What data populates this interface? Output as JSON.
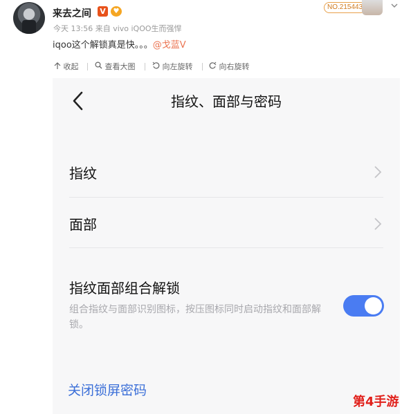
{
  "post": {
    "username": "来去之间",
    "verified_badge": "V",
    "vip_badge": "♥",
    "meta": "今天 13:56 来自 vivo iQOO生而强悍",
    "text": "iqoo这个解锁真是快。。。",
    "mention": "@戈蓝V",
    "fan_tag": "NO.215443"
  },
  "toolbar": {
    "collapse": "收起",
    "view_large": "查看大图",
    "rotate_left": "向左旋转",
    "rotate_right": "向右旋转"
  },
  "screen": {
    "title": "指纹、面部与密码",
    "fingerprint": "指纹",
    "face": "面部",
    "combo_title": "指纹面部组合解锁",
    "combo_desc": "组合指纹与面部识别图标，按压图标同时启动指纹和面部解锁。",
    "combo_enabled": true,
    "close_lock": "关闭锁屏密码"
  },
  "watermark": "第4手游",
  "colors": {
    "accent": "#4a7cf2",
    "link": "#3b6fd8",
    "mention": "#eb7350"
  },
  "icons": [
    "back-arrow-icon",
    "chevron-right-icon",
    "collapse-icon",
    "search-icon",
    "rotate-left-icon",
    "rotate-right-icon"
  ]
}
